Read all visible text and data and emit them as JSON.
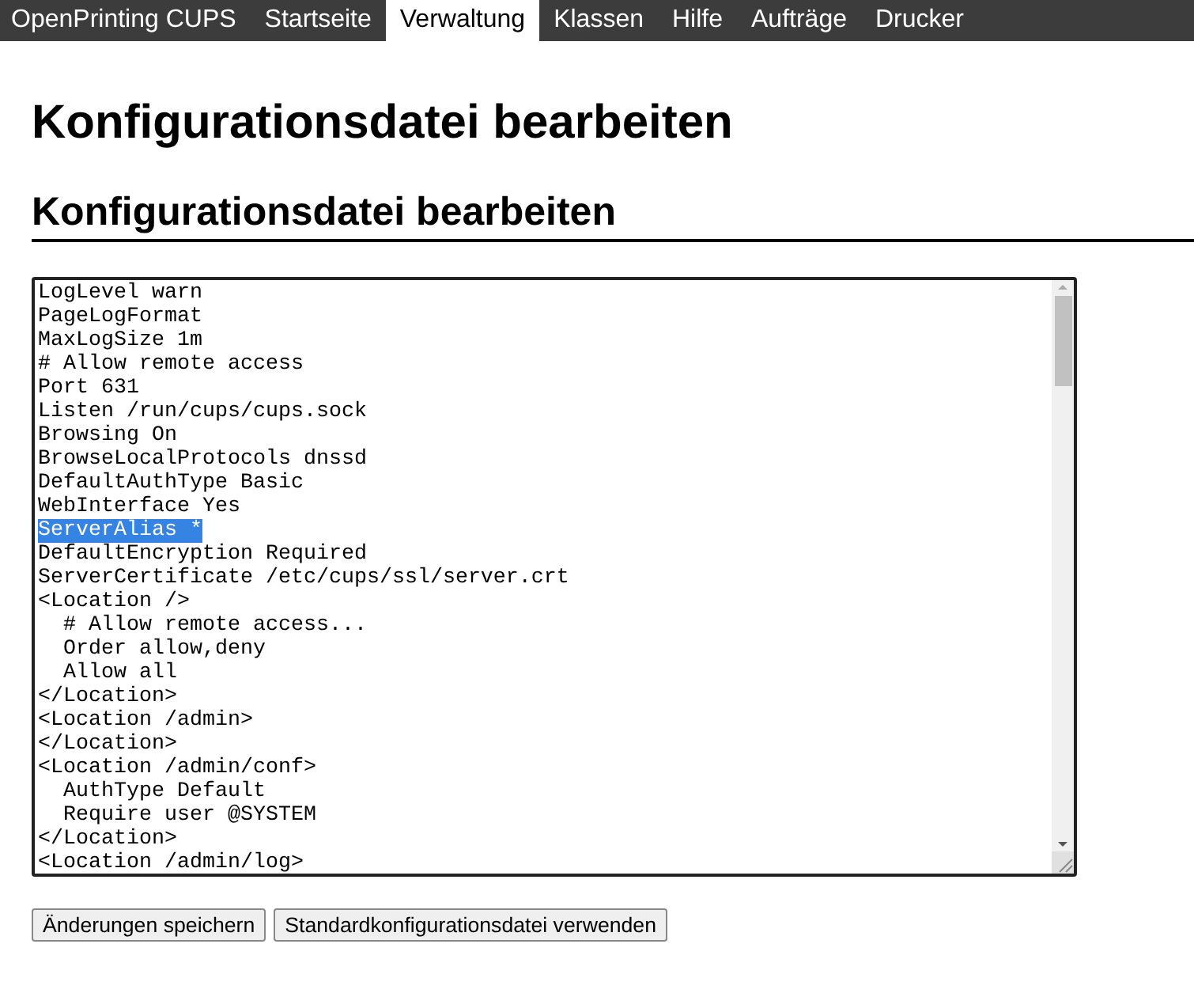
{
  "nav": [
    {
      "label": "OpenPrinting CUPS",
      "selected": false
    },
    {
      "label": "Startseite",
      "selected": false
    },
    {
      "label": "Verwaltung",
      "selected": true
    },
    {
      "label": "Klassen",
      "selected": false
    },
    {
      "label": "Hilfe",
      "selected": false
    },
    {
      "label": "Aufträge",
      "selected": false
    },
    {
      "label": "Drucker",
      "selected": false
    }
  ],
  "page_title": "Konfigurationsdatei bearbeiten",
  "section_title": "Konfigurationsdatei bearbeiten",
  "editor": {
    "lines": [
      {
        "text": "LogLevel warn",
        "selected": false
      },
      {
        "text": "PageLogFormat",
        "selected": false
      },
      {
        "text": "MaxLogSize 1m",
        "selected": false
      },
      {
        "text": "# Allow remote access",
        "selected": false
      },
      {
        "text": "Port 631",
        "selected": false
      },
      {
        "text": "Listen /run/cups/cups.sock",
        "selected": false
      },
      {
        "text": "Browsing On",
        "selected": false
      },
      {
        "text": "BrowseLocalProtocols dnssd",
        "selected": false
      },
      {
        "text": "DefaultAuthType Basic",
        "selected": false
      },
      {
        "text": "WebInterface Yes",
        "selected": false
      },
      {
        "text": "ServerAlias *",
        "selected": true
      },
      {
        "text": "DefaultEncryption Required",
        "selected": false
      },
      {
        "text": "ServerCertificate /etc/cups/ssl/server.crt",
        "selected": false
      },
      {
        "text": "<Location />",
        "selected": false,
        "children": [
          {
            "text": "# Allow remote access...",
            "selected": false
          },
          {
            "text": "Order allow,deny",
            "selected": false
          },
          {
            "text": "Allow all",
            "selected": false
          }
        ]
      },
      {
        "text": "</Location>",
        "selected": false
      },
      {
        "text": "<Location /admin>",
        "selected": false
      },
      {
        "text": "</Location>",
        "selected": false
      },
      {
        "text": "<Location /admin/conf>",
        "selected": false,
        "children": [
          {
            "text": "AuthType Default",
            "selected": false
          },
          {
            "text": "Require user @SYSTEM",
            "selected": false
          }
        ]
      },
      {
        "text": "</Location>",
        "selected": false
      },
      {
        "text": "<Location /admin/log>",
        "selected": false
      }
    ]
  },
  "buttons": [
    "Änderungen speichern",
    "Standardkonfigurationsdatei verwenden"
  ]
}
